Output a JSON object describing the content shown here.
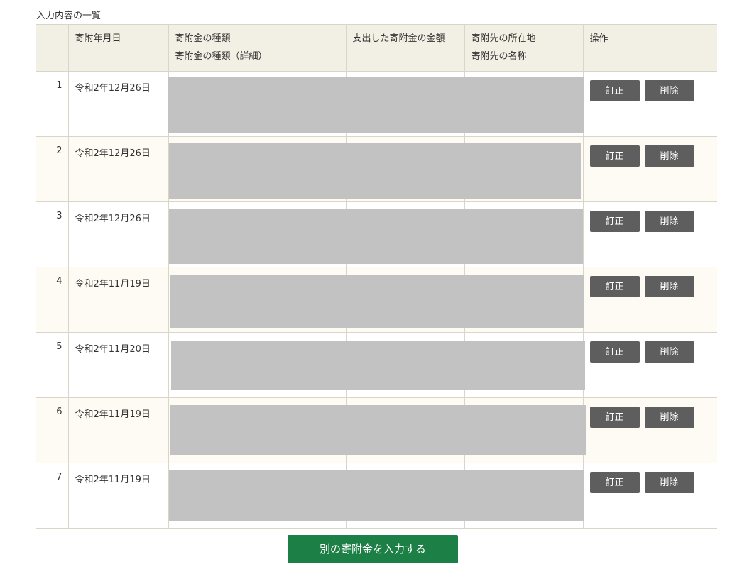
{
  "section_title": "入力内容の一覧",
  "table": {
    "headers": {
      "no": "",
      "date": "寄附年月日",
      "type": "寄附金の種類",
      "type_detail": "寄附金の種類（詳細）",
      "amount": "支出した寄附金の金額",
      "address": "寄附先の所在地",
      "name": "寄附先の名称",
      "ops": "操作"
    },
    "rows": [
      {
        "no": "1",
        "date": "令和2年12月26日"
      },
      {
        "no": "2",
        "date": "令和2年12月26日"
      },
      {
        "no": "3",
        "date": "令和2年12月26日"
      },
      {
        "no": "4",
        "date": "令和2年11月19日"
      },
      {
        "no": "5",
        "date": "令和2年11月20日"
      },
      {
        "no": "6",
        "date": "令和2年11月19日"
      },
      {
        "no": "7",
        "date": "令和2年11月19日"
      }
    ],
    "edit_label": "訂正",
    "delete_label": "削除"
  },
  "add_button_label": "別の寄附金を入力する",
  "colors": {
    "header_bg": "#f2efe4",
    "alt_row_bg": "#fdfbf4",
    "button_gray": "#5e5e5e",
    "primary_green": "#1c7f45",
    "redaction_gray": "#c2c2c2"
  }
}
